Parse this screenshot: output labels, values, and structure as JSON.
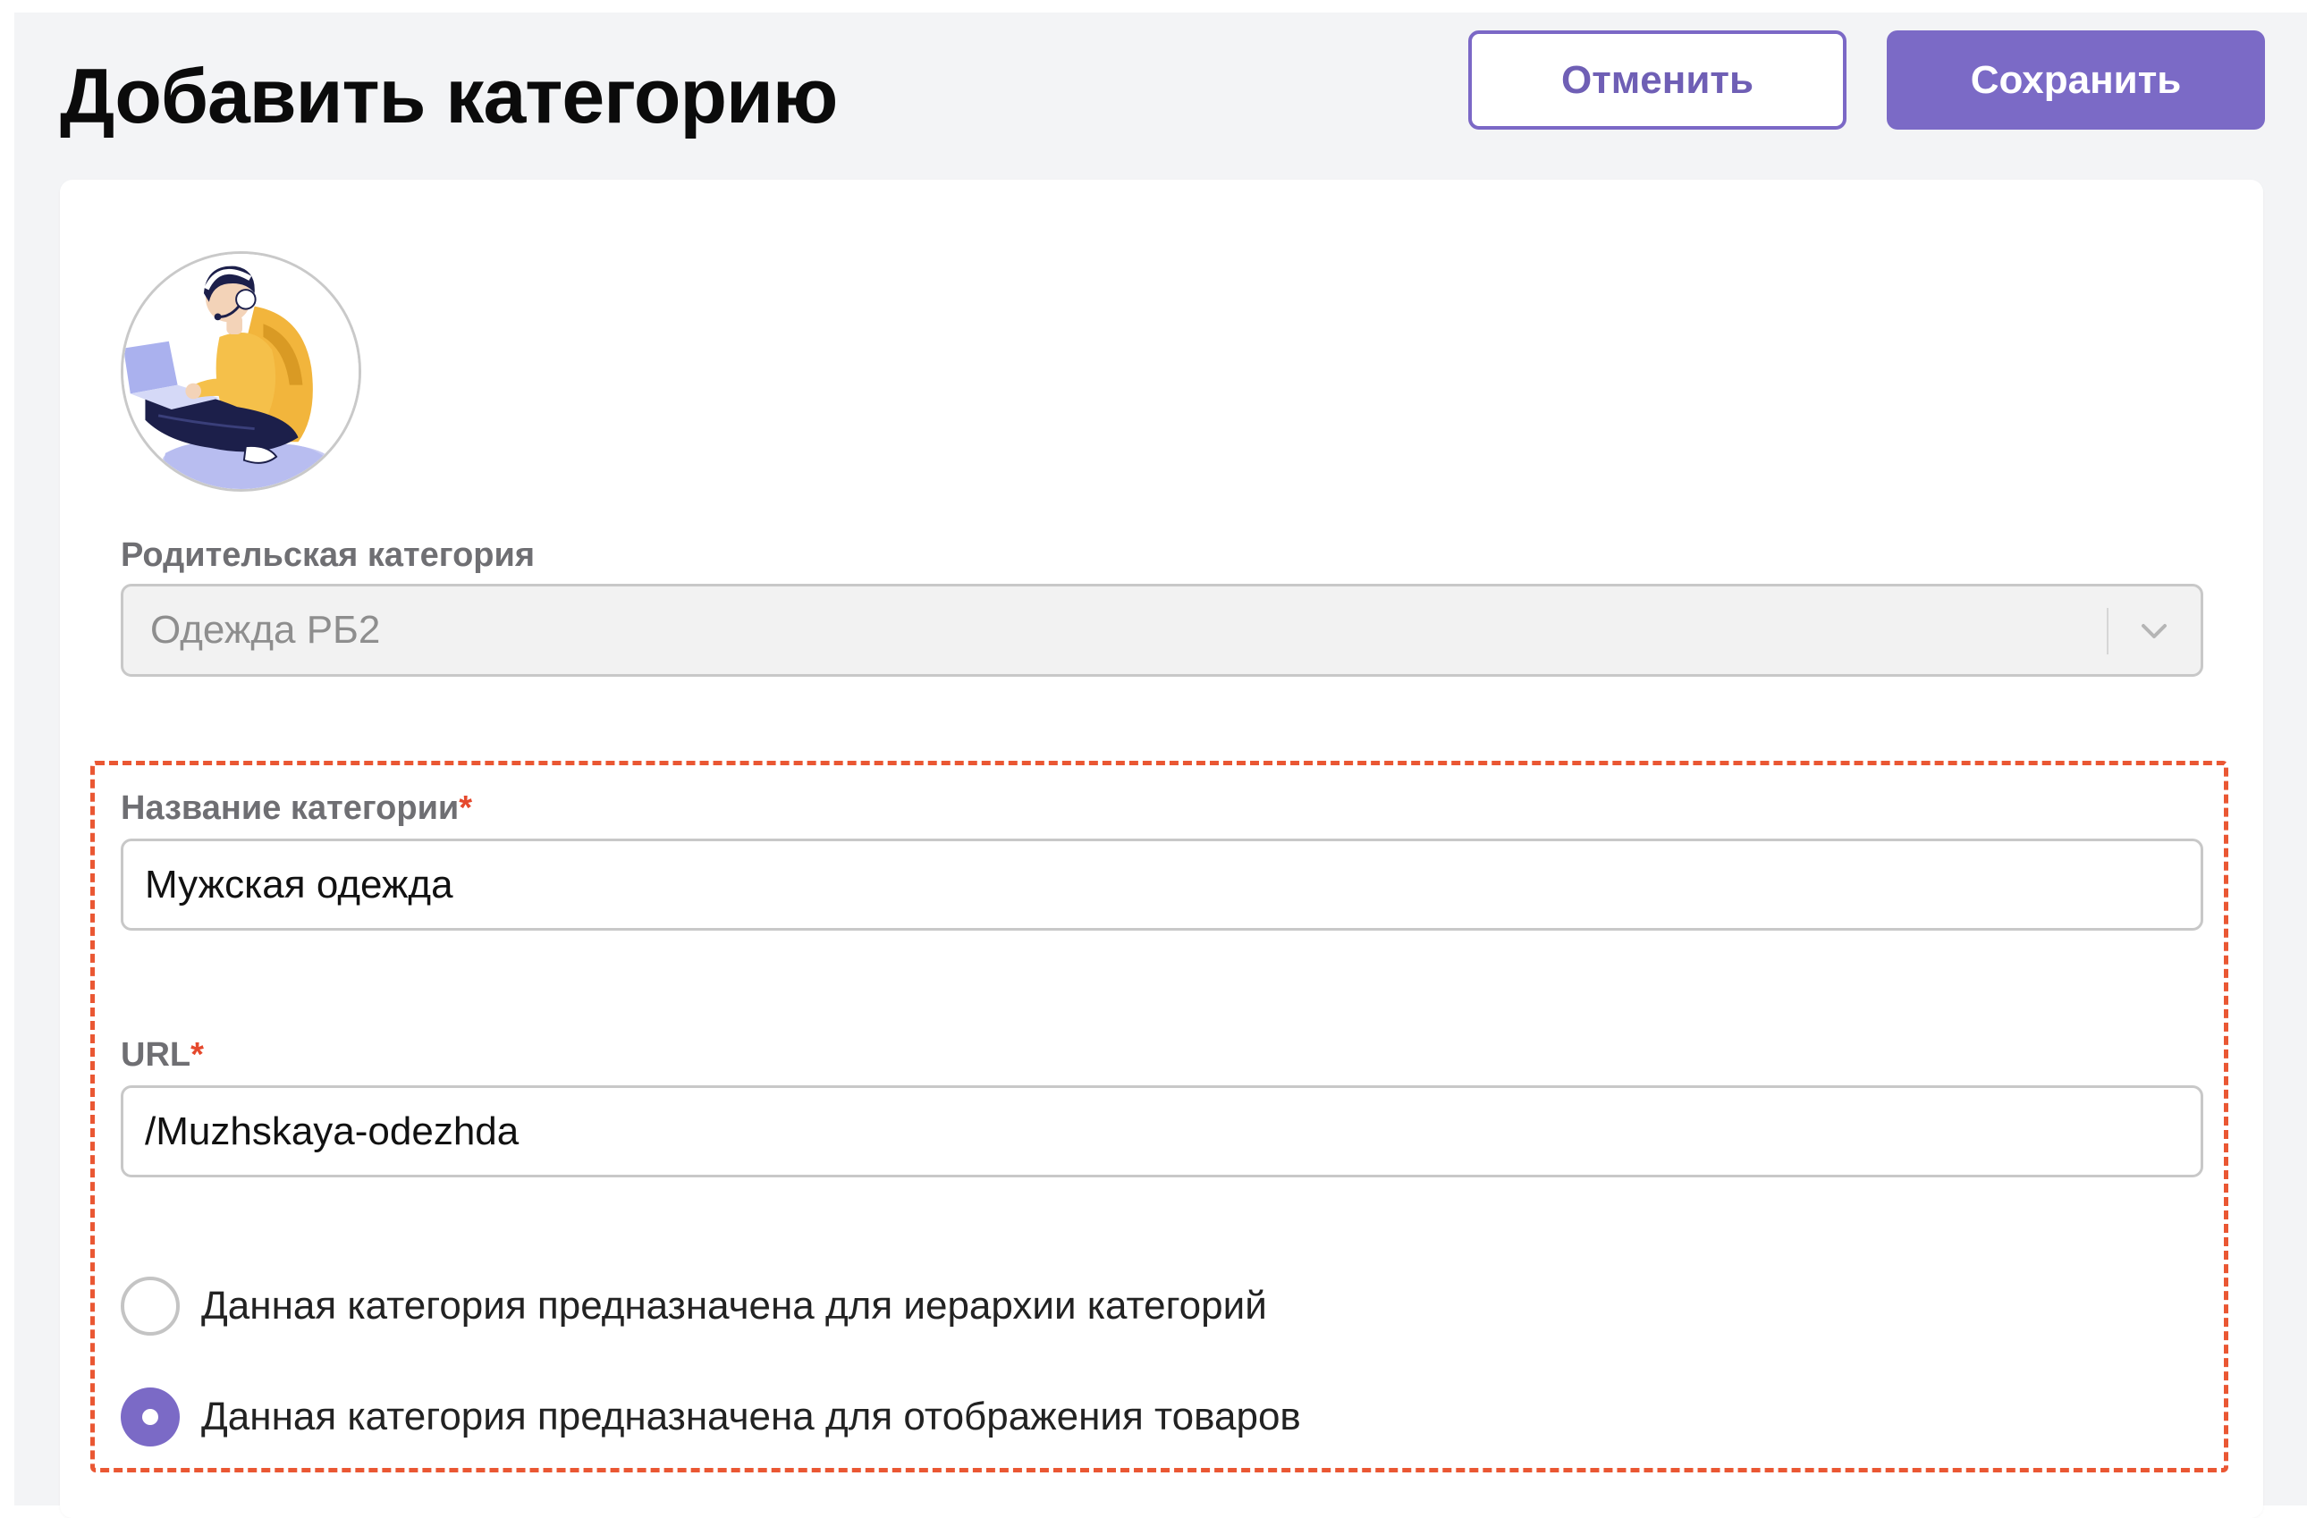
{
  "header": {
    "title": "Добавить категорию",
    "cancel_label": "Отменить",
    "save_label": "Сохранить"
  },
  "form": {
    "avatar_icon": "person-with-laptop-illustration",
    "parent_category": {
      "label": "Родительская категория",
      "value": "Одежда РБ2"
    },
    "name": {
      "label": "Название категории",
      "required_mark": "*",
      "value": "Мужская одежда"
    },
    "url": {
      "label": "URL",
      "required_mark": "*",
      "value": "/Muzhskaya-odezhda"
    },
    "radio_options": [
      {
        "label": "Данная категория предназначена для иерархии категорий",
        "selected": false
      },
      {
        "label": "Данная категория предназначена для отображения товаров",
        "selected": true
      }
    ]
  },
  "colors": {
    "accent": "#7b6ac6",
    "required": "#e5492d",
    "highlight_border": "#ea5733",
    "page_background": "#f3f4f6"
  }
}
